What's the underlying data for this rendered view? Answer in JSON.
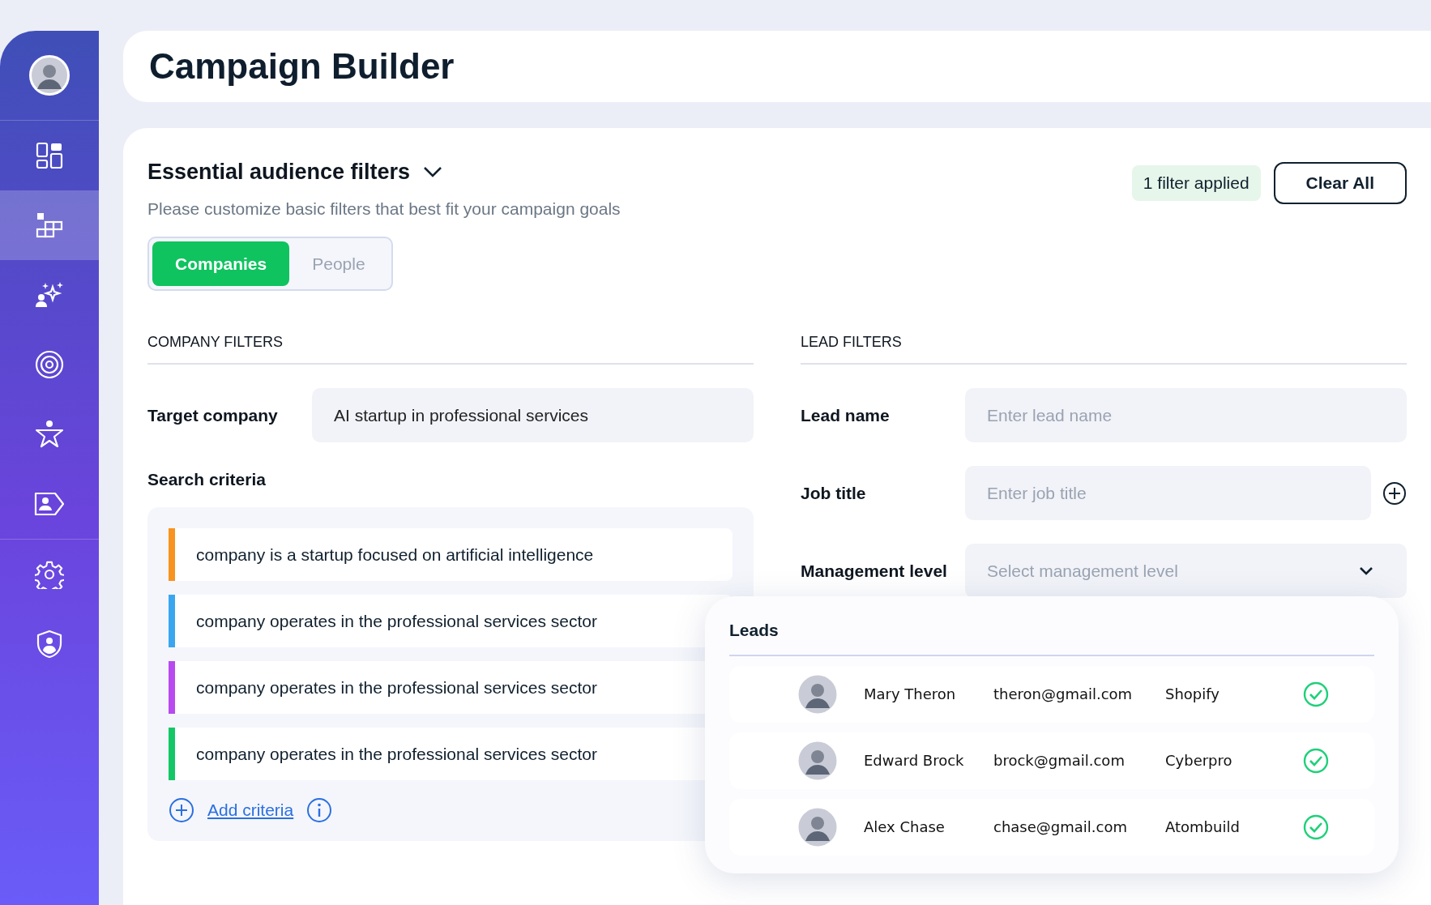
{
  "header": {
    "title": "Campaign Builder"
  },
  "sidebar": {
    "groups": [
      [
        {
          "kind": "avatar"
        }
      ],
      [
        {
          "kind": "dashboard",
          "selected": false
        },
        {
          "kind": "blocks",
          "selected": true
        },
        {
          "kind": "sparkle-person",
          "selected": false
        },
        {
          "kind": "target",
          "selected": false
        },
        {
          "kind": "star-person",
          "selected": false
        },
        {
          "kind": "person-tag",
          "selected": false
        }
      ],
      [
        {
          "kind": "gear",
          "selected": false
        },
        {
          "kind": "shield-person",
          "selected": false
        }
      ]
    ]
  },
  "filters": {
    "title": "Essential audience filters",
    "subtitle": "Please customize basic filters that best fit your campaign goals",
    "badge": "1 filter applied",
    "clear_button": "Clear All",
    "toggle": [
      {
        "label": "Companies",
        "selected": true
      },
      {
        "label": "People",
        "selected": false
      }
    ]
  },
  "company_filters": {
    "heading": "COMPANY FILTERS",
    "target_company": {
      "label": "Target company",
      "value": "AI startup in professional services"
    },
    "search_criteria": {
      "label": "Search criteria",
      "items": [
        {
          "text": "company is a startup focused on artificial intelligence",
          "color": "#f7931e"
        },
        {
          "text": "company operates in the professional services sector",
          "color": "#3aa6f0"
        },
        {
          "text": "company operates in the professional services sector",
          "color": "#b84af0"
        },
        {
          "text": "company operates in the professional services sector",
          "color": "#13c767"
        }
      ],
      "add_link": "Add criteria"
    }
  },
  "lead_filters": {
    "heading": "LEAD FILTERS",
    "fields": [
      {
        "kind": "text",
        "label": "Lead name",
        "placeholder": "Enter lead name"
      },
      {
        "kind": "text-add",
        "label": "Job title",
        "placeholder": "Enter job title"
      },
      {
        "kind": "select",
        "label": "Management level",
        "placeholder": "Select management level"
      }
    ]
  },
  "leads": {
    "title": "Leads",
    "rows": [
      {
        "name": "Mary Theron",
        "email": "theron@gmail.com",
        "company": "Shopify",
        "verified": true
      },
      {
        "name": "Edward Brock",
        "email": "brock@gmail.com",
        "company": "Cyberpro",
        "verified": true
      },
      {
        "name": "Alex Chase",
        "email": "chase@gmail.com",
        "company": "Atombuild",
        "verified": true
      }
    ]
  }
}
